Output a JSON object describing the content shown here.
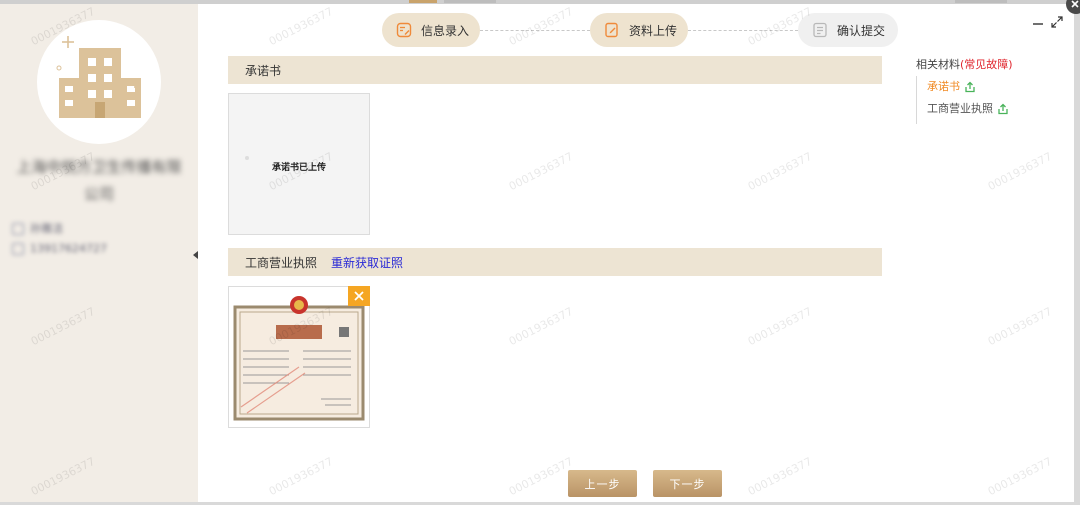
{
  "steps": [
    {
      "label": "信息录入",
      "state": "done"
    },
    {
      "label": "资料上传",
      "state": "done"
    },
    {
      "label": "确认提交",
      "state": "pending"
    }
  ],
  "company": {
    "name": "上海中悦方卫生传播有限公司",
    "contact": "孙雅洁",
    "phone": "13917624727"
  },
  "sections": [
    {
      "title": "承诺书",
      "upload_status": "承诺书已上传"
    },
    {
      "title": "工商营业执照",
      "link": "重新获取证照"
    }
  ],
  "buttons": {
    "prev": "上一步",
    "next": "下一步"
  },
  "related": {
    "title": "相关材料",
    "faq": "(常见故障)",
    "items": [
      {
        "label": "承诺书",
        "active": true
      },
      {
        "label": "工商营业执照",
        "active": false
      }
    ]
  },
  "watermark": "0001936377",
  "colors": {
    "accent": "#c9a36b",
    "step_done_bg": "#eee3cf",
    "section_bg": "#ede4d3",
    "link": "#2a2ad6",
    "warn": "#e0262e",
    "active_item": "#f08a24",
    "remove_badge": "#f5a623"
  }
}
